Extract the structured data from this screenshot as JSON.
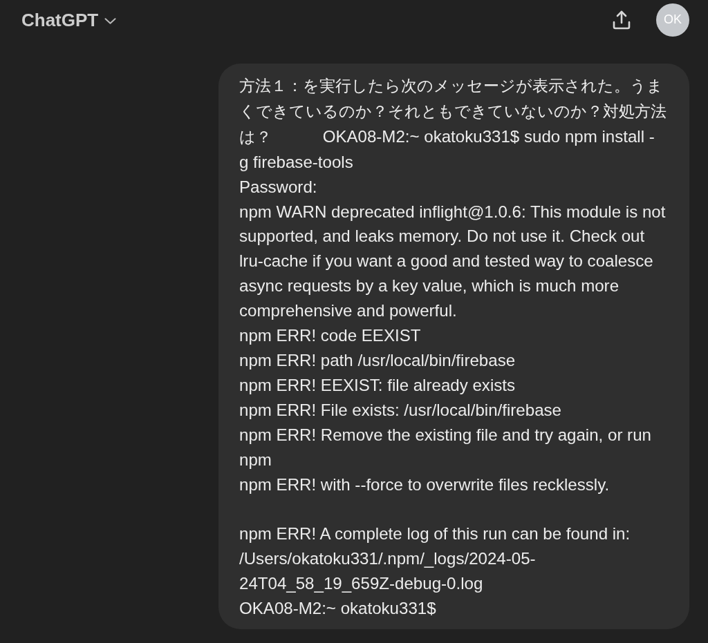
{
  "header": {
    "title": "ChatGPT",
    "avatar_initials": "OK"
  },
  "messages": [
    {
      "kind": "user",
      "text": "方法１：を実行したら次のメッセージが表示された。うまくできているのか？それともできていないのか？対処方法は？           OKA08-M2:~ okatoku331$ sudo npm install -\ng firebase-tools\nPassword:\nnpm WARN deprecated inflight@1.0.6: This module is not\nsupported, and leaks memory. Do not use it. Check out\nlru-cache if you want a good and tested way to coalesce\nasync requests by a key value, which is much more\ncomprehensive and powerful.\nnpm ERR! code EEXIST\nnpm ERR! path /usr/local/bin/firebase\nnpm ERR! EEXIST: file already exists\nnpm ERR! File exists: /usr/local/bin/firebase\nnpm ERR! Remove the existing file and try again, or run\nnpm\nnpm ERR! with --force to overwrite files recklessly.\n\nnpm ERR! A complete log of this run can be found in:\n/Users/okatoku331/.npm/_logs/2024-05-\n24T04_58_19_659Z-debug-0.log\nOKA08-M2:~ okatoku331$"
    }
  ]
}
